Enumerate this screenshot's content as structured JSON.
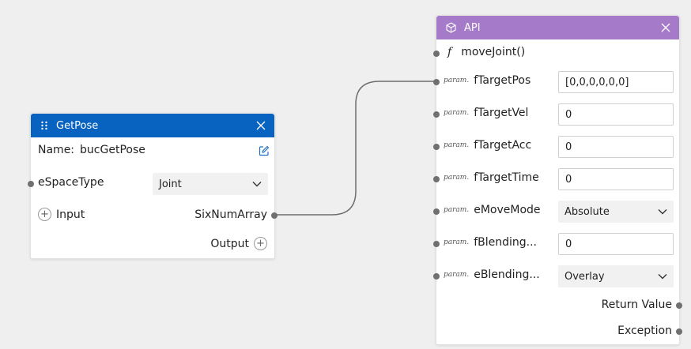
{
  "getpose_node": {
    "title": "GetPose",
    "name_label": "Name:",
    "name_value": "bucGetPose",
    "espacetype_label": "eSpaceType",
    "espacetype_value": "Joint",
    "input_label": "Input",
    "sixnumarray_label": "SixNumArray",
    "output_label": "Output"
  },
  "api_node": {
    "title": "API",
    "function_symbol": "f",
    "function_name": "moveJoint()",
    "param_tag": "param.",
    "params": [
      {
        "name": "fTargetPos",
        "value": "[0,0,0,0,0,0]"
      },
      {
        "name": "fTargetVel",
        "value": "0"
      },
      {
        "name": "fTargetAcc",
        "value": "0"
      },
      {
        "name": "fTargetTime",
        "value": "0"
      },
      {
        "name": "eMoveMode",
        "value": "Absolute"
      },
      {
        "name": "fBlending...",
        "value": "0"
      },
      {
        "name": "eBlending...",
        "value": "Overlay"
      }
    ],
    "return_value_label": "Return Value",
    "exception_label": "Exception"
  },
  "colors": {
    "canvas": "#efefef",
    "getpose_header": "#0862c0",
    "api_header": "#a57ac8",
    "port": "#707070",
    "edit_icon": "#1f6fc6"
  }
}
